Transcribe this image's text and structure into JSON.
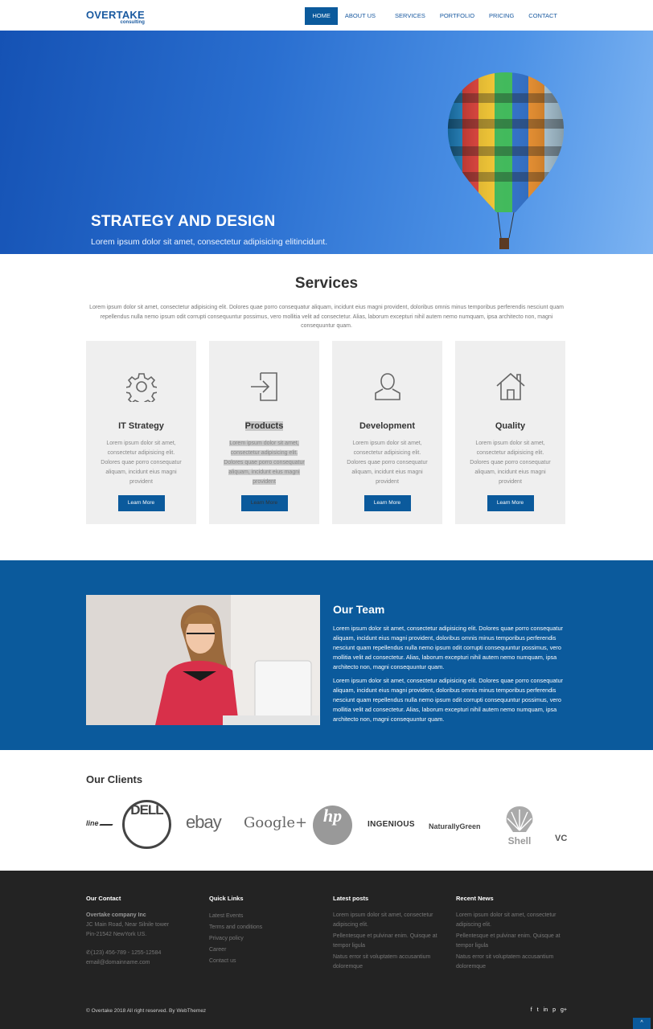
{
  "brand": {
    "name": "OVERTAKE",
    "tagline": "consulting",
    "color": "#1a5aa0"
  },
  "nav": [
    {
      "label": "HOME",
      "active": true
    },
    {
      "label": "ABOUT US"
    },
    {
      "label": "SERVICES"
    },
    {
      "label": "PORTFOLIO"
    },
    {
      "label": "PRICING"
    },
    {
      "label": "CONTACT"
    }
  ],
  "hero": {
    "title": "STRATEGY AND DESIGN",
    "subtitle": "Lorem ipsum dolor sit amet, consectetur adipisicing elitincidunt."
  },
  "services": {
    "title": "Services",
    "description": "Lorem ipsum dolor sit amet, consectetur adipisicing elit. Dolores quae porro consequatur aliquam, incidunt eius magni provident, doloribus omnis minus temporibus perferendis nesciunt quam repellendus nulla nemo ipsum odit corrupti consequuntur possimus, vero mollitia velit ad consectetur. Alias, laborum excepturi nihil autem nemo numquam, ipsa architecto non, magni consequuntur quam.",
    "cards": [
      {
        "icon": "gear-icon",
        "title": "IT Strategy",
        "text": "Lorem ipsum dolor sit amet, consectetur adipisicing elit. Dolores quae porro consequatur aliquam, incidunt eius magni provident",
        "button": "Learn More"
      },
      {
        "icon": "sign-in-icon",
        "title": "Products",
        "text": "Lorem ipsum dolor sit amet, consectetur adipisicing elit. Dolores quae porro consequatur aliquam, incidunt eius magni provident",
        "button": "Learn More"
      },
      {
        "icon": "user-icon",
        "title": "Development",
        "text": "Lorem ipsum dolor sit amet, consectetur adipisicing elit. Dolores quae porro consequatur aliquam, incidunt eius magni provident",
        "button": "Learn More"
      },
      {
        "icon": "home-icon",
        "title": "Quality",
        "text": "Lorem ipsum dolor sit amet, consectetur adipisicing elit. Dolores quae porro consequatur aliquam, incidunt eius magni provident",
        "button": "Learn More"
      }
    ]
  },
  "team": {
    "title": "Our Team",
    "p1": "Lorem ipsum dolor sit amet, consectetur adipisicing elit. Dolores quae porro consequatur aliquam, incidunt eius magni provident, doloribus omnis minus temporibus perferendis nesciunt quam repellendus nulla nemo ipsum odit corrupti consequuntur possimus, vero mollitia velit ad consectetur. Alias, laborum excepturi nihil autem nemo numquam, ipsa architecto non, magni consequuntur quam.",
    "p2": "Lorem ipsum dolor sit amet, consectetur adipisicing elit. Dolores quae porro consequatur aliquam, incidunt eius magni provident, doloribus omnis minus temporibus perferendis nesciunt quam repellendus nulla nemo ipsum odit corrupti consequuntur possimus, vero mollitia velit ad consectetur. Alias, laborum excepturi nihil autem nemo numquam, ipsa architecto non, magni consequuntur quam."
  },
  "clients": {
    "title": "Our Clients",
    "logos": [
      "line",
      "DELL",
      "ebay",
      "Google+",
      "hp",
      "INGENIOUS",
      "NaturallyGreen",
      "Shell",
      "VC"
    ]
  },
  "footer": {
    "contact": {
      "title": "Our Contact",
      "company": "Overtake company Inc",
      "address1": "JC Main Road, Near Silnile tower",
      "address2": "Pin-21542 NewYork US.",
      "phone": "(123) 456-789 - 1255-12584",
      "email": "email@domainname.com"
    },
    "quick_links": {
      "title": "Quick Links",
      "items": [
        "Latest Events",
        "Terms and conditions",
        "Privacy policy",
        "Career",
        "Contact us"
      ]
    },
    "latest_posts": {
      "title": "Latest posts",
      "items": [
        "Lorem ipsum dolor sit amet, consectetur adipiscing elit.",
        "Pellentesque et pulvinar enim. Quisque at tempor ligula",
        "Natus error sit voluptatem accusantium doloremque"
      ]
    },
    "recent_news": {
      "title": "Recent News",
      "items": [
        "Lorem ipsum dolor sit amet, consectetur adipiscing elit.",
        "Pellentesque et pulvinar enim. Quisque at tempor ligula",
        "Natus error sit voluptatem accusantium doloremque"
      ]
    },
    "copyright": "© Overtake 2018 All right reserved. By WebThemez",
    "social": [
      "f",
      "t",
      "in",
      "p",
      "g+"
    ],
    "to_top": "^"
  },
  "colors": {
    "primary": "#0b5a9c",
    "footer_bg": "#232323",
    "card_bg": "#efefef"
  }
}
